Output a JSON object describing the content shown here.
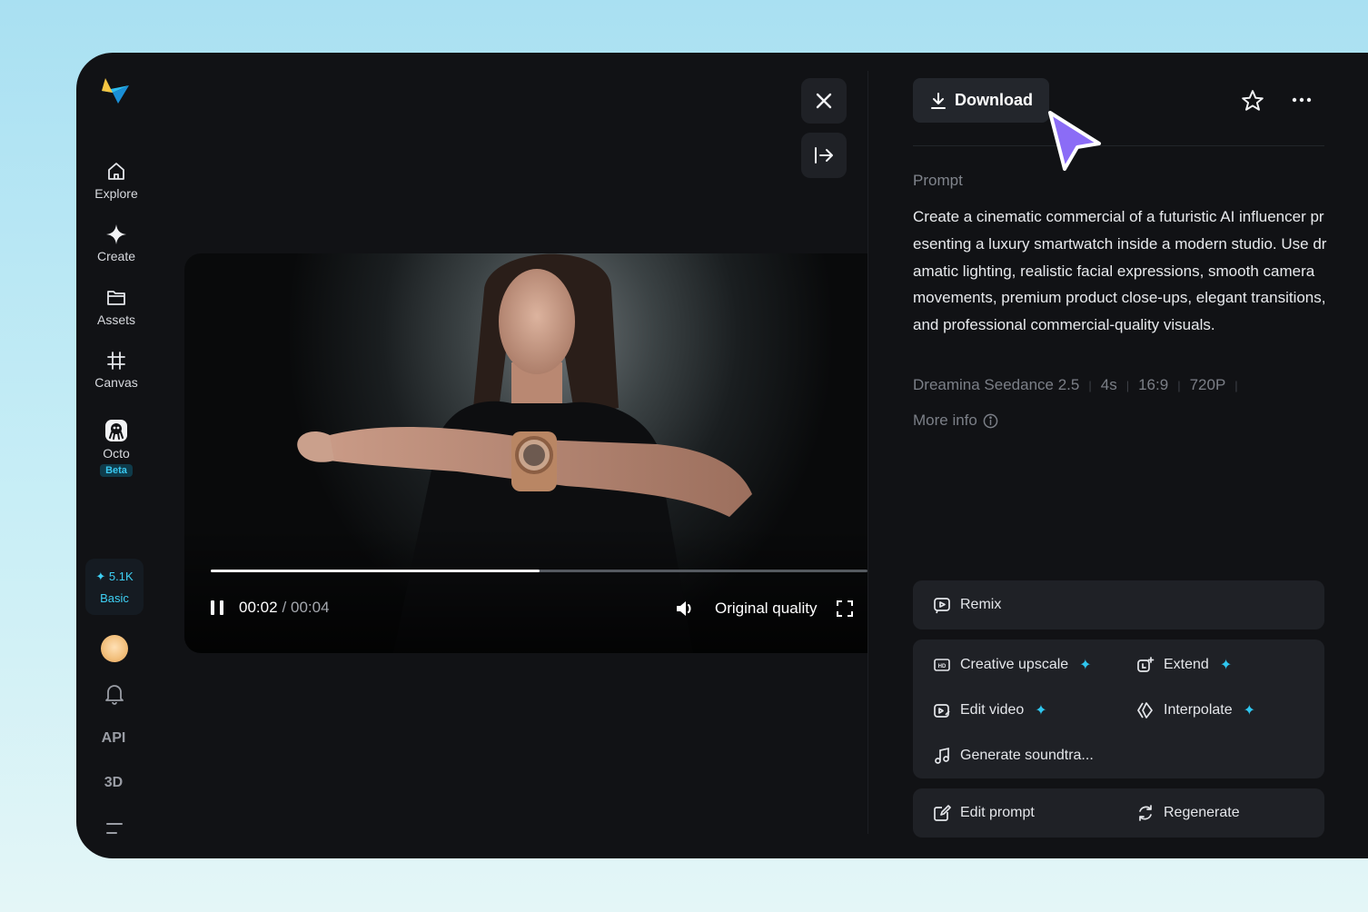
{
  "sidebar": {
    "items": [
      {
        "label": "Explore",
        "icon": "home-icon"
      },
      {
        "label": "Create",
        "icon": "sparkle-icon"
      },
      {
        "label": "Assets",
        "icon": "folder-icon"
      },
      {
        "label": "Canvas",
        "icon": "canvas-icon"
      },
      {
        "label": "Octo",
        "icon": "octo-icon",
        "badge": "Beta"
      }
    ],
    "credits": {
      "amount": "5.1K",
      "plan": "Basic"
    },
    "api_label": "API",
    "three_d_label": "3D"
  },
  "player": {
    "current_time": "00:02",
    "total_time": "/ 00:04",
    "progress_fraction": 0.5,
    "quality_label": "Original quality"
  },
  "panel": {
    "download_label": "Download",
    "prompt_label": "Prompt",
    "prompt_text": "Create a cinematic commercial of a futuristic AI influencer presenting a luxury smartwatch inside a modern studio. Use dramatic lighting, realistic facial expressions, smooth camera movements, premium product close-ups, elegant transitions, and professional commercial-quality visuals.",
    "meta": [
      "Dreamina Seedance 2.5",
      "4s",
      "16:9",
      "720P"
    ],
    "more_info_label": "More info",
    "actions": {
      "remix": "Remix",
      "creative_upscale": "Creative upscale",
      "extend": "Extend",
      "edit_video": "Edit video",
      "interpolate": "Interpolate",
      "generate_soundtrack": "Generate soundtra...",
      "edit_prompt": "Edit prompt",
      "regenerate": "Regenerate"
    }
  },
  "colors": {
    "accent": "#2fc6ef",
    "cursor": "#8b6cf6",
    "background": "#111215"
  }
}
